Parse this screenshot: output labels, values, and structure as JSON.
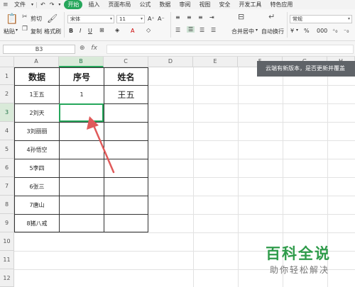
{
  "menubar": {
    "file": "文件",
    "tabs": [
      "开始",
      "插入",
      "页面布局",
      "公式",
      "数据",
      "审阅",
      "视图",
      "安全",
      "开发工具",
      "特色应用"
    ],
    "active_tab": 0
  },
  "ribbon": {
    "cut": "剪切",
    "copy": "复制",
    "format_painter": "格式刷",
    "paste": "粘贴",
    "font": "宋体",
    "font_size": "11",
    "merge_center": "合并居中",
    "wrap_text": "自动换行",
    "number_format": "常规",
    "percent": "%",
    "thousands": "000"
  },
  "formula_bar": {
    "cell_ref": "B3",
    "fx": "fx",
    "zoom_icon": "zoom-icon",
    "content": ""
  },
  "columns": [
    "A",
    "B",
    "C",
    "D",
    "E",
    "F",
    "G",
    "H"
  ],
  "selected_column": "B",
  "rows": [
    "1",
    "2",
    "3",
    "4",
    "5",
    "6",
    "7",
    "8",
    "9",
    "10",
    "11",
    "12"
  ],
  "selected_row": "3",
  "cells": {
    "A1": "数据",
    "B1": "序号",
    "C1": "姓名",
    "A2": "1王五",
    "B2": "1",
    "C2": "王五",
    "A3": "2刘天",
    "A4": "3刘丽丽",
    "A5": "4孙悟空",
    "A6": "5李四",
    "A7": "6张三",
    "A8": "7唐山",
    "A9": "8猪八戒"
  },
  "notice": "云端有新版本，是否更新并覆盖",
  "watermark": {
    "title": "百科全说",
    "subtitle": "助你轻松解决"
  },
  "colors": {
    "accent": "#26a65b",
    "arrow": "#e05a5a",
    "watermark": "#2e9b4a"
  }
}
